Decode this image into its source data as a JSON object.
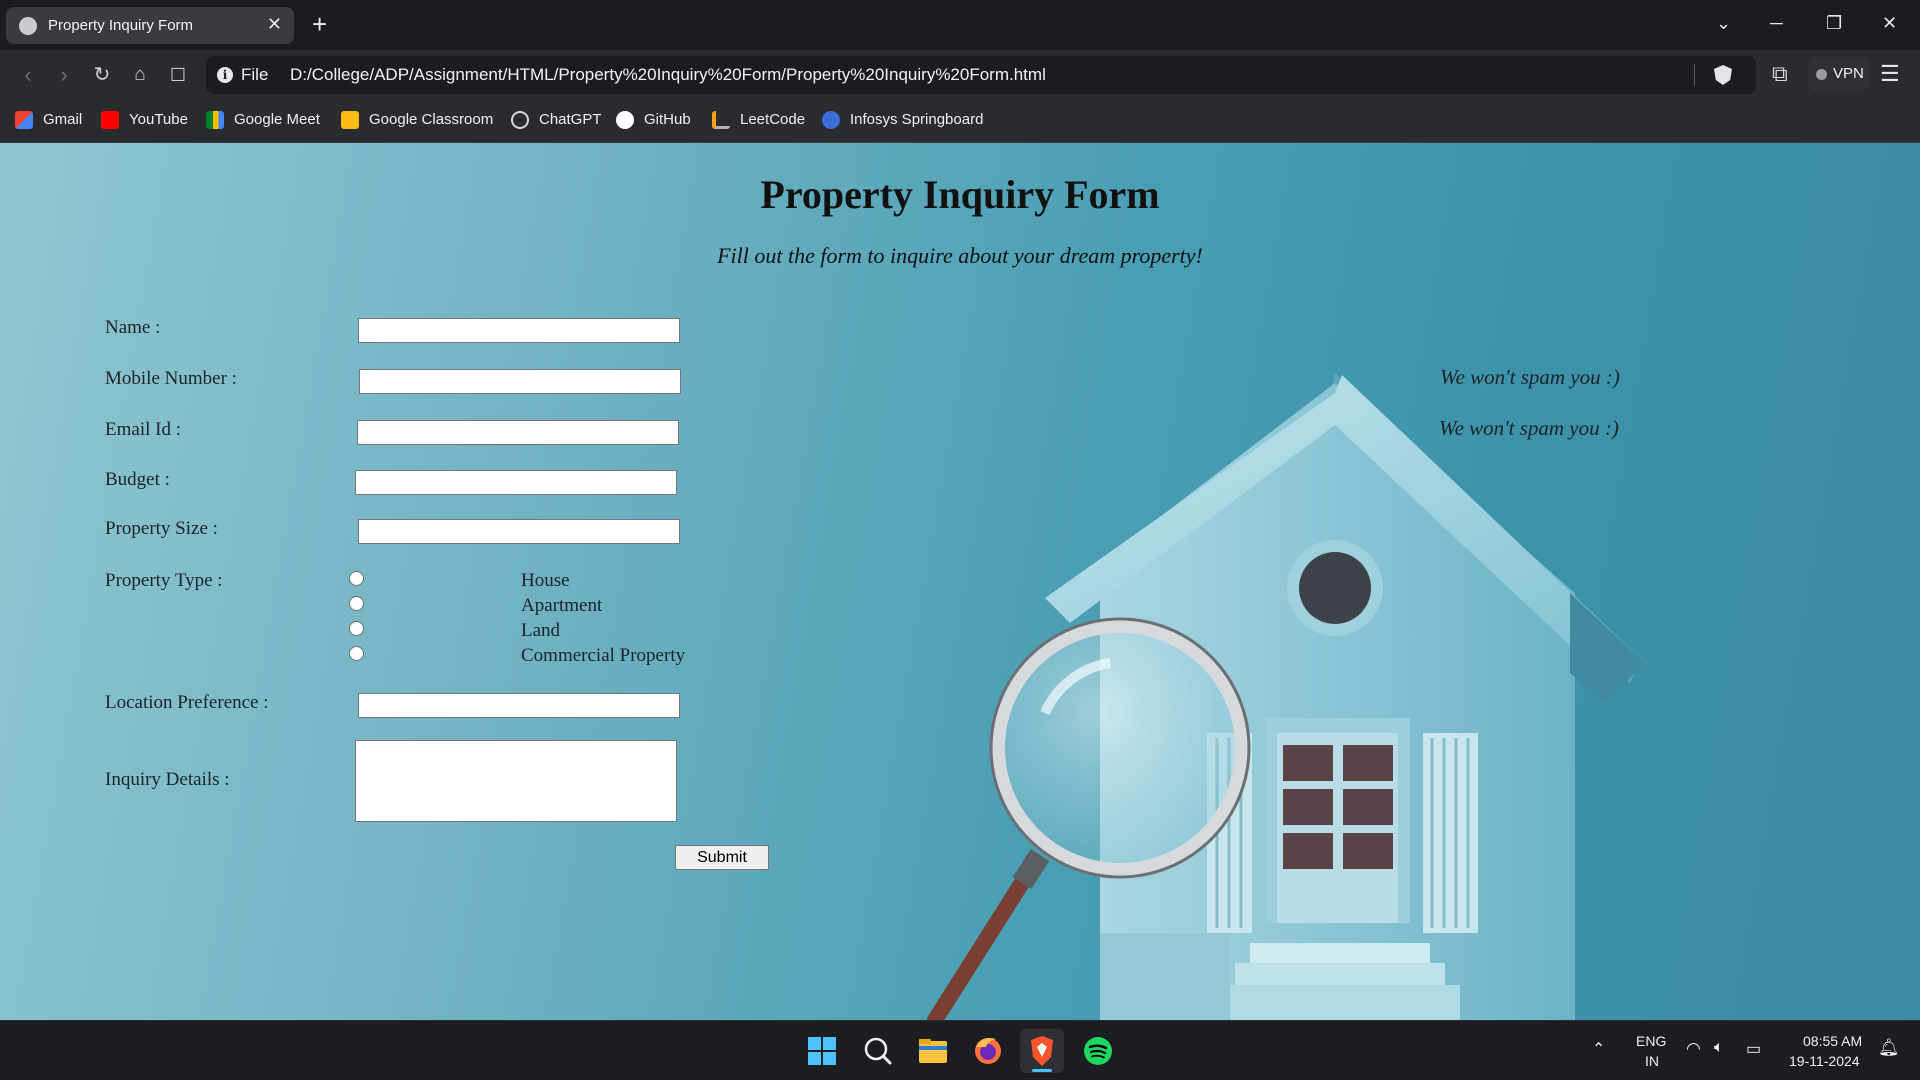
{
  "browser": {
    "tab_title": "Property Inquiry Form",
    "scheme_label": "File",
    "url": "D:/College/ADP/Assignment/HTML/Property%20Inquiry%20Form/Property%20Inquiry%20Form.html",
    "vpn_label": "VPN"
  },
  "bookmarks": [
    {
      "label": "Gmail",
      "icon": "gmail-icon",
      "color": "#ea4335"
    },
    {
      "label": "YouTube",
      "icon": "youtube-icon",
      "color": "#ff0000"
    },
    {
      "label": "Google Meet",
      "icon": "google-meet-icon",
      "color": "#00832d"
    },
    {
      "label": "Google Classroom",
      "icon": "google-classroom-icon",
      "color": "#f9bc15"
    },
    {
      "label": "ChatGPT",
      "icon": "chatgpt-icon",
      "color": "#d9d9d9"
    },
    {
      "label": "GitHub",
      "icon": "github-icon",
      "color": "#ffffff"
    },
    {
      "label": "LeetCode",
      "icon": "leetcode-icon",
      "color": "#ffa116"
    },
    {
      "label": "Infosys Springboard",
      "icon": "infosys-springboard-icon",
      "color": "#3b6fd8"
    }
  ],
  "form": {
    "title": "Property Inquiry Form",
    "subtitle": "Fill out the form to inquire about your dream property!",
    "labels": {
      "name": "Name :",
      "mobile": "Mobile Number :",
      "email": "Email Id :",
      "budget": "Budget :",
      "size": "Property Size :",
      "type": "Property Type :",
      "location": "Location Preference :",
      "details": "Inquiry Details :"
    },
    "values": {
      "name": "",
      "mobile": "",
      "email": "",
      "budget": "",
      "size": "",
      "location": "",
      "details": ""
    },
    "property_types": [
      "House",
      "Apartment",
      "Land",
      "Commercial Property"
    ],
    "notes": {
      "mobile": "We won't spam you :)",
      "email": "We won't spam you :)"
    },
    "submit_label": "Submit"
  },
  "taskbar": {
    "apps": [
      "windows-start-icon",
      "search-icon",
      "file-explorer-icon",
      "firefox-icon",
      "brave-icon",
      "spotify-icon"
    ],
    "language": "ENG",
    "region": "IN",
    "time": "08:55 AM",
    "date": "19-11-2024"
  },
  "colors": {
    "page_bg": "#4b9fb4",
    "chrome_dark": "#1b1c1f",
    "brave_orange": "#fb542b",
    "spotify_green": "#1ed760"
  }
}
